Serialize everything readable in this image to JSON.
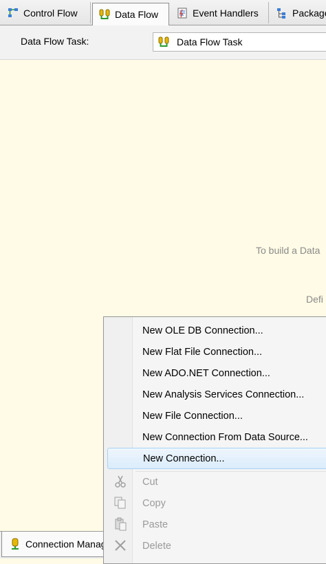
{
  "tabs": [
    {
      "label": "Control Flow",
      "icon": "control-flow-icon",
      "active": false
    },
    {
      "label": "Data Flow",
      "icon": "data-flow-icon",
      "active": true
    },
    {
      "label": "Event Handlers",
      "icon": "event-handlers-icon",
      "active": false
    },
    {
      "label": "Package Explorer",
      "icon": "package-explorer-icon",
      "active": false
    }
  ],
  "task_bar": {
    "label": "Data Flow Task:",
    "selected": "Data Flow Task"
  },
  "canvas": {
    "hint_line1": "To build a Data",
    "hint_line2": "Defi"
  },
  "bottom_tab": {
    "label": "Connection Managers"
  },
  "context_menu": {
    "items": [
      {
        "label": "New OLE DB Connection...",
        "enabled": true
      },
      {
        "label": "New Flat File Connection...",
        "enabled": true
      },
      {
        "label": "New ADO.NET Connection...",
        "enabled": true
      },
      {
        "label": "New Analysis Services Connection...",
        "enabled": true
      },
      {
        "label": "New File Connection...",
        "enabled": true
      },
      {
        "label": "New Connection From Data Source...",
        "enabled": true
      },
      {
        "label": "New Connection...",
        "enabled": true,
        "highlighted": true
      },
      {
        "label": "Cut",
        "enabled": false,
        "icon": "scissors-icon"
      },
      {
        "label": "Copy",
        "enabled": false,
        "icon": "copy-icon"
      },
      {
        "label": "Paste",
        "enabled": false,
        "icon": "paste-icon"
      },
      {
        "label": "Delete",
        "enabled": false,
        "icon": "delete-x-icon"
      }
    ]
  },
  "colors": {
    "canvas_bg": "#fffbe6",
    "highlight_border": "#a8d2f4",
    "disabled_text": "#9a9a9a"
  }
}
